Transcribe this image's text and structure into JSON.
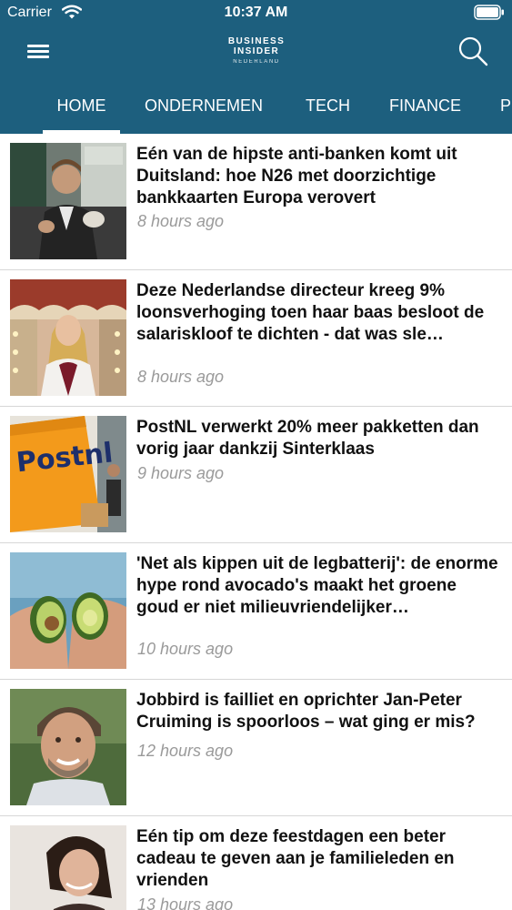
{
  "status_bar": {
    "carrier": "Carrier",
    "time": "10:37 AM"
  },
  "header": {
    "logo": {
      "line1": "BUSINESS",
      "line2": "INSIDER",
      "line3": "NEDERLAND"
    },
    "tabs": [
      {
        "label": "HOME",
        "active": true
      },
      {
        "label": "ONDERNEMEN"
      },
      {
        "label": "TECH"
      },
      {
        "label": "FINANCE"
      },
      {
        "label": "P"
      }
    ]
  },
  "colors": {
    "header_bg": "#1d5f7e",
    "divider": "#d7d7d7",
    "timestamp": "#9a9a9a"
  },
  "articles": [
    {
      "title": "Eén van de hipste anti-banken komt uit Duitsland: hoe N26 met doorzichtige bankkaarten Europa verovert",
      "time": "8 hours ago"
    },
    {
      "title": "Deze Nederlandse directeur kreeg 9% loonsverhoging toen haar baas besloot de salariskloof te dichten - dat was sle…",
      "time": "8 hours ago"
    },
    {
      "title": "PostNL verwerkt 20% meer pakketten dan vorig jaar dankzij Sinterklaas",
      "time": "9 hours ago"
    },
    {
      "title": "'Net als kippen uit de legbatterij': de enorme hype rond avocado's maakt het groene goud er niet milieuvriendelijker…",
      "time": "10 hours ago"
    },
    {
      "title": "Jobbird is failliet en oprichter Jan-Peter Cruiming is spoorloos – wat ging er mis?",
      "time": "12 hours ago"
    },
    {
      "title": "Eén tip om deze feestdagen een beter cadeau te geven aan je familieleden en vrienden",
      "time": "13 hours ago"
    }
  ],
  "images": {
    "postnl_logo": "Postnl"
  }
}
